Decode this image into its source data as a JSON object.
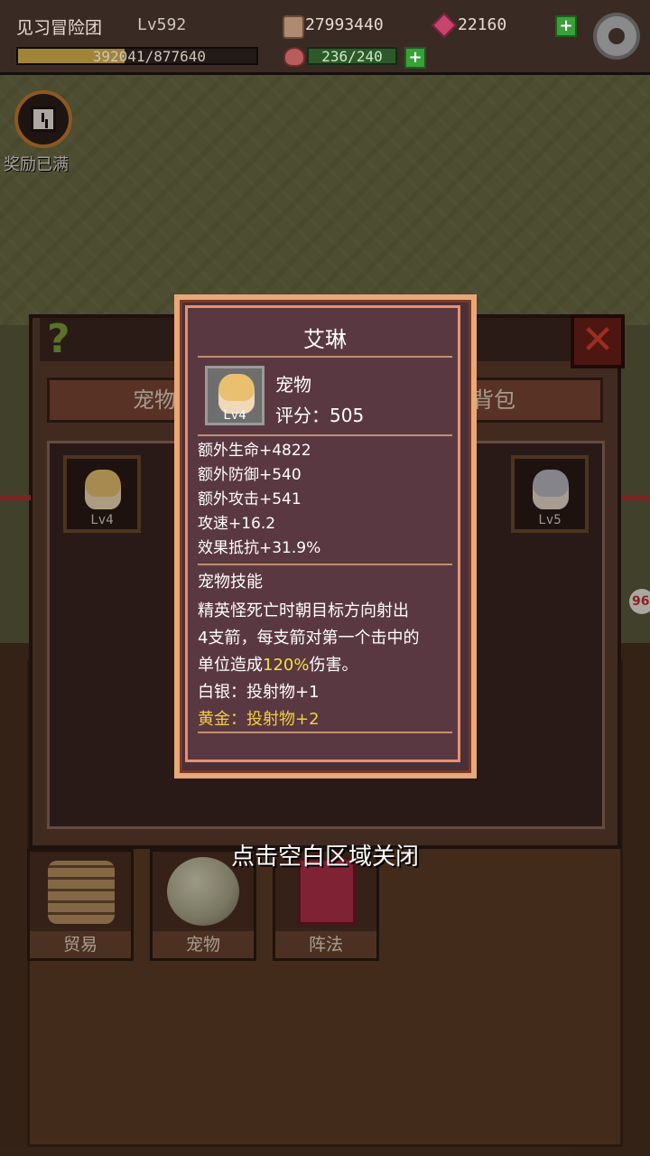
{
  "topbar": {
    "team_name": "见习冒险团",
    "level": "Lv592",
    "coins": "27993440",
    "gems": "22160",
    "exp_current": "392041",
    "exp_text": "392041/877640",
    "exp_progress": 0.4467,
    "stamina": "236/240",
    "plus": "+",
    "icons": [
      "coin-icon",
      "gem-icon",
      "gear-icon",
      "meat-icon"
    ]
  },
  "reward": {
    "label": "奖励已满",
    "icon": "clock-icon"
  },
  "panel": {
    "help": "?",
    "close": "✕",
    "tab_pets": "宠物",
    "tab_bag": "背包",
    "slots": [
      {
        "level": "Lv4"
      },
      {
        "level": "Lv5"
      }
    ],
    "badge": "96"
  },
  "bottom": {
    "buttons": [
      {
        "label": "贸易"
      },
      {
        "label": "宠物"
      },
      {
        "label": "阵法"
      }
    ]
  },
  "hint": "点击空白区域关闭",
  "popup": {
    "name": "艾琳",
    "type": "宠物",
    "score": "评分：505",
    "level": "Lv4",
    "stats": [
      "额外生命+4822",
      "额外防御+540",
      "额外攻击+541",
      "攻速+16.2",
      "效果抵抗+31.9%"
    ],
    "skill_title": "宠物技能",
    "skill_line1": "精英怪死亡时朝目标方向射出",
    "skill_line2": "4支箭，每支箭对第一个击中的",
    "skill_line3_a": "单位造成",
    "skill_line3_hl": "120%",
    "skill_line3_b": "伤害。",
    "silver": "白银：投射物+1",
    "gold": "黄金：投射物+2"
  },
  "colors": {
    "highlight": "#f0e040",
    "popup_bg": "#5a3842",
    "popup_border": "#e8a878"
  }
}
